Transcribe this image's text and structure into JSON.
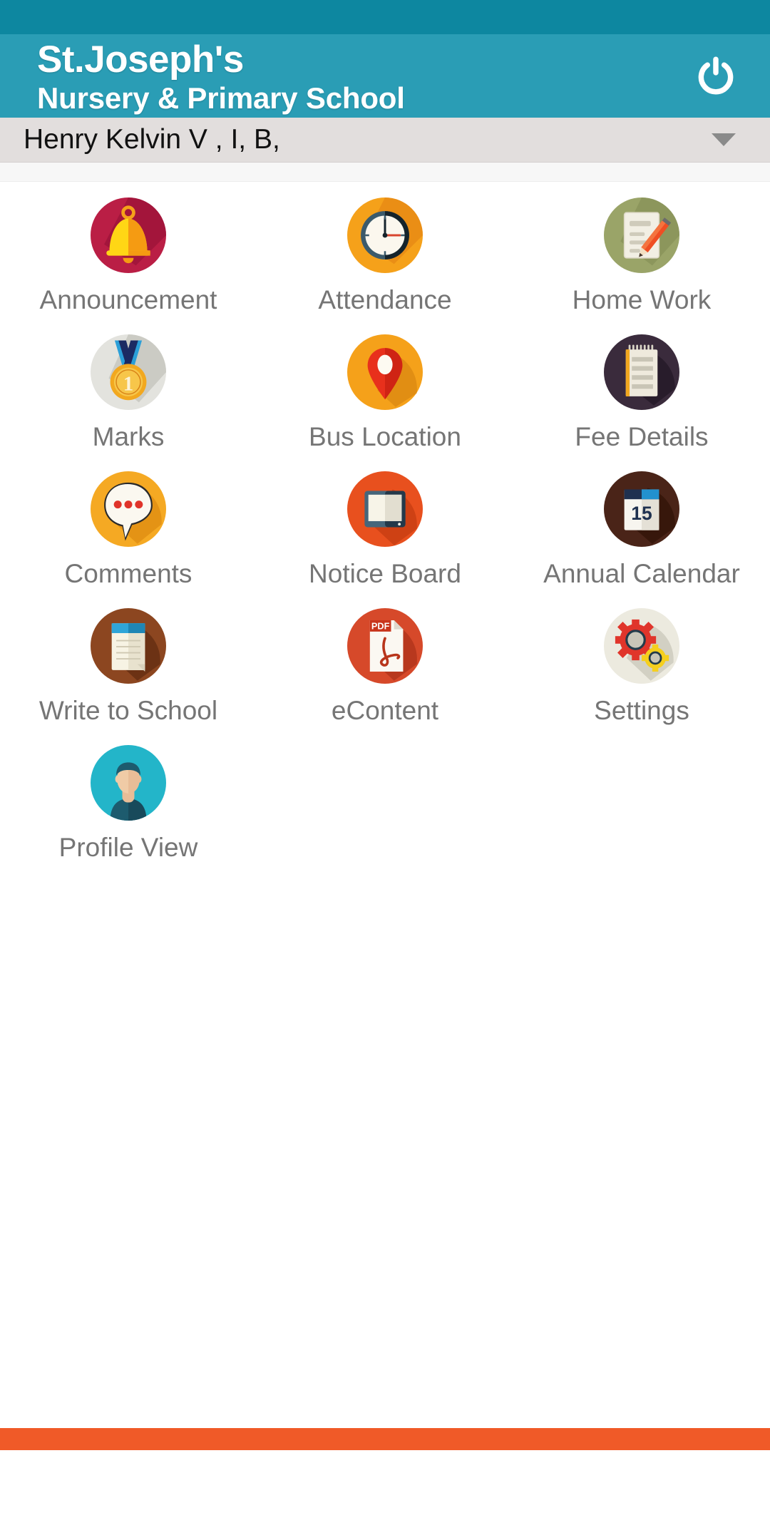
{
  "header": {
    "brand_line1": "St.Joseph's",
    "brand_line2": "Nursery & Primary School",
    "power_icon": "power-icon",
    "bg_color": "#2a9db5",
    "statusbar_color": "#0d87a0"
  },
  "selector": {
    "value": "Henry Kelvin V , I, B,",
    "caret_icon": "chevron-down-icon",
    "bg_color": "#e2dedd"
  },
  "grid": {
    "items": [
      {
        "label": "Announcement",
        "icon": "bell-icon",
        "bg": "#ba1e45"
      },
      {
        "label": "Attendance",
        "icon": "clock-icon",
        "bg": "#f5a11a"
      },
      {
        "label": "Home Work",
        "icon": "note-pencil-icon",
        "bg": "#9aa468"
      },
      {
        "label": "Marks",
        "icon": "medal-icon",
        "bg": "#e0e0dc"
      },
      {
        "label": "Bus Location",
        "icon": "map-pin-icon",
        "bg": "#f5a11a"
      },
      {
        "label": "Fee Details",
        "icon": "notepad-icon",
        "bg": "#3a2b3c"
      },
      {
        "label": "Comments",
        "icon": "speech-bubble-icon",
        "bg": "#f5a923"
      },
      {
        "label": "Notice Board",
        "icon": "tablet-board-icon",
        "bg": "#e8501e"
      },
      {
        "label": "Annual Calendar",
        "icon": "calendar-icon",
        "bg": "#4a2418",
        "calendar_day": "15"
      },
      {
        "label": "Write to School",
        "icon": "notebook-icon",
        "bg": "#8c4620"
      },
      {
        "label": "eContent",
        "icon": "pdf-file-icon",
        "bg": "#d6492a",
        "badge": "PDF"
      },
      {
        "label": "Settings",
        "icon": "gears-icon",
        "bg": "#e8e8e0"
      },
      {
        "label": "Profile View",
        "icon": "avatar-icon",
        "bg": "#23b5c9"
      }
    ]
  },
  "footer": {
    "accent_color": "#f05a28"
  }
}
